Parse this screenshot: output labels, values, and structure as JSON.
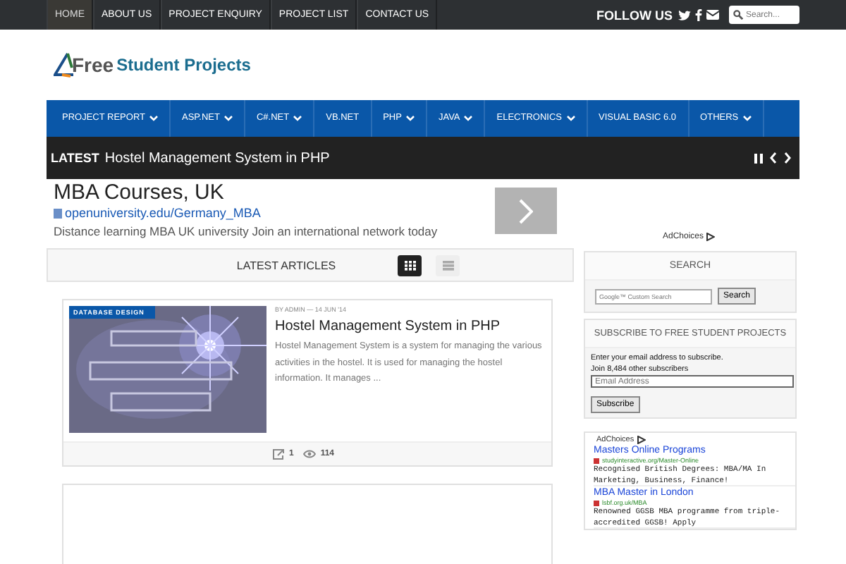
{
  "top_nav": {
    "items": [
      {
        "label": "HOME",
        "selected": true
      },
      {
        "label": "ABOUT US",
        "selected": false
      },
      {
        "label": "PROJECT ENQUIRY",
        "selected": false
      },
      {
        "label": "PROJECT LIST",
        "selected": false
      },
      {
        "label": "CONTACT US",
        "selected": false
      }
    ],
    "follow_label": "FOLLOW US",
    "search": {
      "placeholder": "Search..."
    }
  },
  "logo": {
    "first": "Free",
    "second": "Student Projects"
  },
  "main_nav": [
    {
      "label": "PROJECT REPORT",
      "dropdown": true
    },
    {
      "label": "ASP.NET",
      "dropdown": true
    },
    {
      "label": "C#.NET",
      "dropdown": true
    },
    {
      "label": "VB.NET",
      "dropdown": false
    },
    {
      "label": "PHP",
      "dropdown": true
    },
    {
      "label": "JAVA",
      "dropdown": true
    },
    {
      "label": "ELECTRONICS",
      "dropdown": true
    },
    {
      "label": "VISUAL BASIC 6.0",
      "dropdown": false
    },
    {
      "label": "OTHERS",
      "dropdown": true
    }
  ],
  "ticker": {
    "label": "LATEST",
    "title": "Hostel Management System in PHP"
  },
  "ad": {
    "title": "MBA Courses, UK",
    "url": "openuniversity.edu/Germany_MBA",
    "description": "Distance learning MBA UK university Join an international network today"
  },
  "articles_header": {
    "title": "LATEST ARTICLES",
    "views": [
      {
        "kind": "grid",
        "selected": true
      },
      {
        "kind": "list",
        "selected": false
      }
    ]
  },
  "articles": [
    {
      "category": "DATABASE DESIGN",
      "meta": "BY ADMIN — 14 JUN '14",
      "title": "Hostel Management System in PHP",
      "excerpt": "Hostel Management System is a system for managing the various activities in the hostel. It is used for managing the hostel information. It manages ...",
      "shares": "1",
      "views": "114"
    }
  ],
  "sidebar": {
    "adchoices": "AdChoices",
    "search": {
      "title": "SEARCH",
      "placeholder": "Google™ Custom Search",
      "button": "Search"
    },
    "subscribe": {
      "title": "SUBSCRIBE TO FREE STUDENT PROJECTS",
      "text": "Enter your email address to subscribe.",
      "count": "Join 8,484 other subscribers",
      "placeholder": "Email Address",
      "button": "Subscribe"
    },
    "ads": {
      "label": "AdChoices",
      "items": [
        {
          "title": "Masters Online Programs",
          "url": "studyinteractive.org/Master-Online",
          "description": "Recognised British Degrees: MBA/MA In Marketing, Business, Finance!"
        },
        {
          "title": "MBA Master in London",
          "url": "lsbf.org.uk/MBA",
          "description": "Renowned GGSB MBA programme from triple-accredited GGSB! Apply"
        }
      ]
    }
  }
}
